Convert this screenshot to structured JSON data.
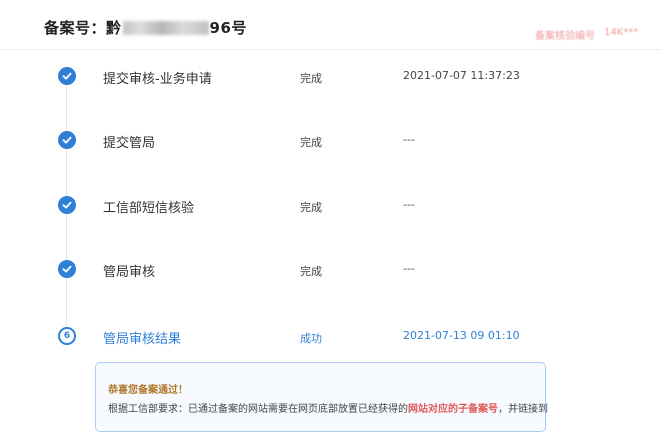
{
  "header": {
    "label": "备案号：",
    "number_prefix": "黔",
    "number_suffix": "96号",
    "right_link": "备案核验编号",
    "right_code": "14K***"
  },
  "steps": [
    {
      "name": "提交审核-业务申请",
      "status": "完成",
      "time": "2021-07-07 11:37:23",
      "icon": "check-icon"
    },
    {
      "name": "提交管局",
      "status": "完成",
      "time": "---",
      "icon": "check-icon"
    },
    {
      "name": "工信部短信核验",
      "status": "完成",
      "time": "---",
      "icon": "check-icon"
    },
    {
      "name": "管局审核",
      "status": "完成",
      "time": "---",
      "icon": "check-icon"
    },
    {
      "name": "管局审核结果",
      "status": "成功",
      "time": "2021-07-13 09 01:10",
      "number": "6",
      "icon": "step-number-icon"
    }
  ],
  "notice": {
    "title": "恭喜您备案通过！",
    "body_prefix": "根据工信部要求：已通过备案的网站需要在网页底部放置已经获得的",
    "body_highlight": "网站对应的子备案号",
    "body_suffix": "，并链接到"
  },
  "colors": {
    "accent": "#2f7fd8",
    "highlight": "#e05a5a",
    "notice_title": "#b07a2e"
  }
}
